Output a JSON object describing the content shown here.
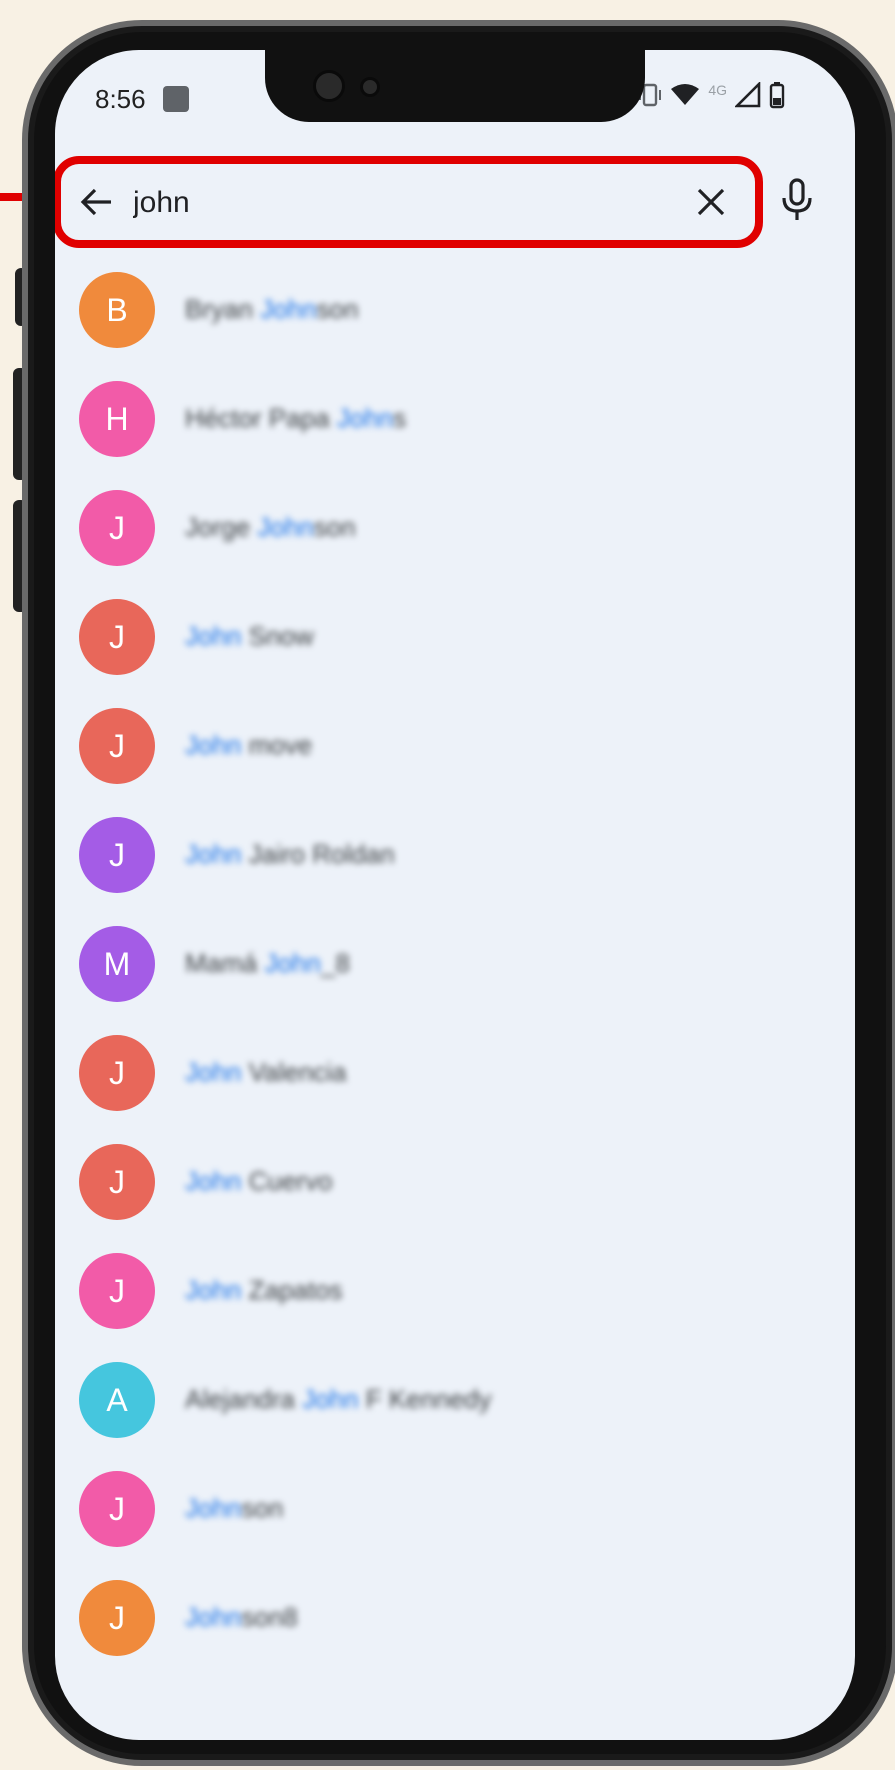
{
  "status_bar": {
    "time": "8:56",
    "network": "4G"
  },
  "search": {
    "query": "john"
  },
  "contacts": [
    {
      "initial": "B",
      "color": "#f08a3c",
      "before": "Bryan ",
      "match": "John",
      "after": "son"
    },
    {
      "initial": "H",
      "color": "#f25ba8",
      "before": "Héctor Papa ",
      "match": "John",
      "after": "s"
    },
    {
      "initial": "J",
      "color": "#f25ba8",
      "before": "Jorge ",
      "match": "John",
      "after": "son"
    },
    {
      "initial": "J",
      "color": "#e8675a",
      "before": "",
      "match": "John",
      "after": " Snow"
    },
    {
      "initial": "J",
      "color": "#e8675a",
      "before": "",
      "match": "John",
      "after": " move"
    },
    {
      "initial": "J",
      "color": "#a45ce6",
      "before": "",
      "match": "John",
      "after": " Jairo Roldan"
    },
    {
      "initial": "M",
      "color": "#a45ce6",
      "before": "Mamá ",
      "match": "John",
      "after": "_8"
    },
    {
      "initial": "J",
      "color": "#e8675a",
      "before": "",
      "match": "John",
      "after": " Valencia"
    },
    {
      "initial": "J",
      "color": "#e8675a",
      "before": "",
      "match": "John",
      "after": " Cuervo"
    },
    {
      "initial": "J",
      "color": "#f25ba8",
      "before": "",
      "match": "John",
      "after": " Zapatos"
    },
    {
      "initial": "A",
      "color": "#45c6de",
      "before": "Alejandra ",
      "match": "John",
      "after": " F Kennedy"
    },
    {
      "initial": "J",
      "color": "#f25ba8",
      "before": "",
      "match": "John",
      "after": "son"
    },
    {
      "initial": "J",
      "color": "#f08a3c",
      "before": "",
      "match": "John",
      "after": "son8"
    }
  ],
  "colors": {
    "highlight": "#1a73e8",
    "callout": "#e00000",
    "background": "#edf2f9"
  }
}
